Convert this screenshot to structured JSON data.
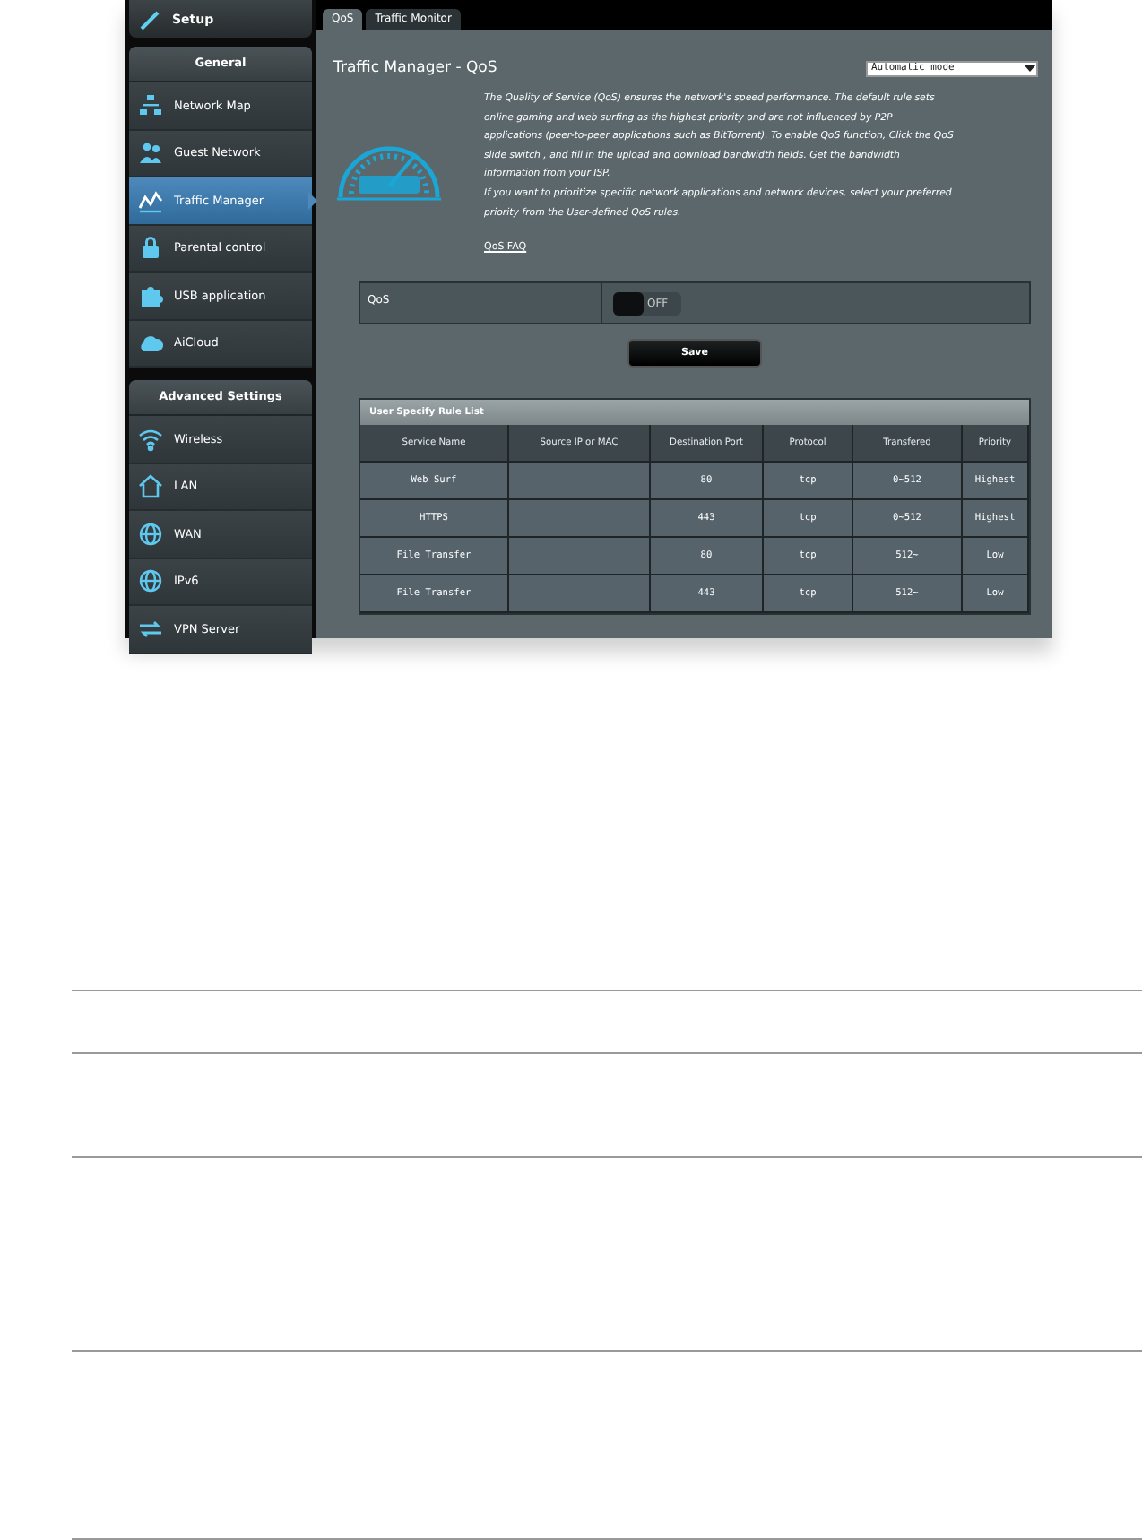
{
  "sidebar": {
    "setup_label": "Setup",
    "groups": [
      {
        "title": "General",
        "items": [
          {
            "label": "Network Map",
            "selected": false
          },
          {
            "label": "Guest Network",
            "selected": false
          },
          {
            "label": "Traffic Manager",
            "selected": true
          },
          {
            "label": "Parental control",
            "selected": false
          },
          {
            "label": "USB application",
            "selected": false
          },
          {
            "label": "AiCloud",
            "selected": false
          }
        ]
      },
      {
        "title": "Advanced Settings",
        "items": [
          {
            "label": "Wireless",
            "selected": false
          },
          {
            "label": "LAN",
            "selected": false
          },
          {
            "label": "WAN",
            "selected": false
          },
          {
            "label": "IPv6",
            "selected": false
          },
          {
            "label": "VPN Server",
            "selected": false
          }
        ]
      }
    ]
  },
  "tabs": [
    {
      "label": "QoS",
      "selected": true
    },
    {
      "label": "Traffic Monitor",
      "selected": false
    }
  ],
  "panel": {
    "title": "Traffic Manager - QoS",
    "mode_select": {
      "value": "Automatic mode"
    },
    "description": [
      "The Quality of Service (QoS) ensures the network's speed performance. The default rule sets online gaming and web surfing as the highest priority and are not influenced by P2P applications (peer-to-peer applications such as BitTorrent). To enable QoS function, Click the QoS slide switch , and fill in the upload and download bandwidth fields. Get the bandwidth information from your ISP.",
      "If you want to prioritize specific network applications and network devices, select your preferred priority from the User-defined QoS rules."
    ],
    "faq_link": "QoS FAQ",
    "qos_setting": {
      "label": "QoS",
      "switch_text": "OFF",
      "on": false
    },
    "save_button": "Save",
    "rule_table": {
      "title": "User Specify Rule List",
      "columns": [
        "Service Name",
        "Source IP or MAC",
        "Destination Port",
        "Protocol",
        "Transfered",
        "Priority"
      ],
      "rows": [
        {
          "service": "Web Surf",
          "port": "80",
          "protocol": "tcp",
          "transfered": "0~512",
          "priority": "Highest"
        },
        {
          "service": "HTTPS",
          "port": "443",
          "protocol": "tcp",
          "transfered": "0~512",
          "priority": "Highest"
        },
        {
          "service": "File Transfer",
          "port": "80",
          "protocol": "tcp",
          "transfered": "512~",
          "priority": "Low"
        },
        {
          "service": "File Transfer",
          "port": "443",
          "protocol": "tcp",
          "transfered": "512~",
          "priority": "Low"
        }
      ]
    }
  }
}
